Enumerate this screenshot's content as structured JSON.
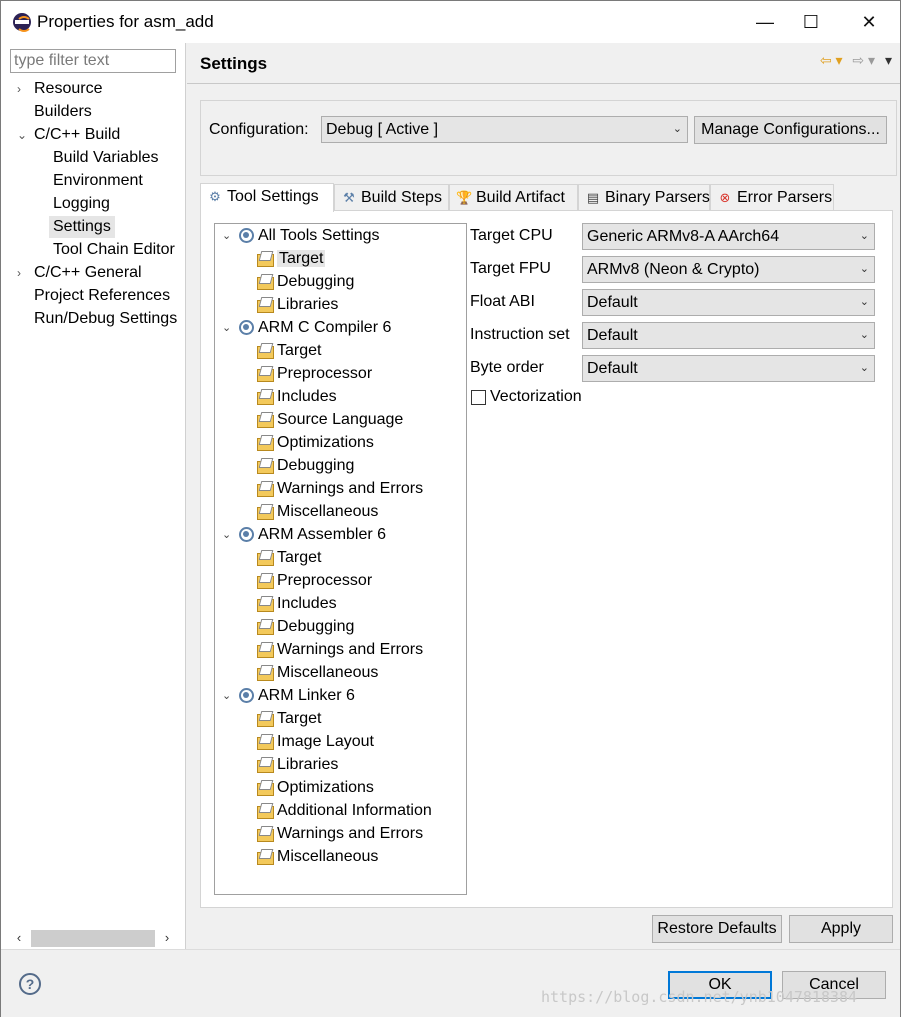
{
  "window": {
    "title": "Properties for asm_add",
    "minimize": "—",
    "maximize": "☐",
    "close": "✕"
  },
  "sidebar": {
    "filter_placeholder": "type filter text",
    "items": [
      {
        "label": "Resource",
        "arrow": "›"
      },
      {
        "label": "Builders",
        "arrow": ""
      },
      {
        "label": "C/C++ Build",
        "arrow": "⌄"
      },
      {
        "label": "Build Variables",
        "arrow": ""
      },
      {
        "label": "Environment",
        "arrow": ""
      },
      {
        "label": "Logging",
        "arrow": ""
      },
      {
        "label": "Settings",
        "arrow": "",
        "selected": true
      },
      {
        "label": "Tool Chain Editor",
        "arrow": ""
      },
      {
        "label": "C/C++ General",
        "arrow": "›"
      },
      {
        "label": "Project References",
        "arrow": ""
      },
      {
        "label": "Run/Debug Settings",
        "arrow": ""
      }
    ],
    "scroll_left": "‹",
    "scroll_right": "›"
  },
  "page": {
    "heading": "Settings",
    "nav_back": "⇦ ▾",
    "nav_forward": "⇨ ▾",
    "nav_menu": "▾"
  },
  "configuration": {
    "label": "Configuration:",
    "value": "Debug  [ Active ]",
    "manage_button": "Manage Configurations..."
  },
  "tabs": [
    {
      "label": "Tool Settings",
      "icon": "tool-settings-icon",
      "active": true
    },
    {
      "label": "Build Steps",
      "icon": "build-steps-icon"
    },
    {
      "label": "Build Artifact",
      "icon": "trophy-icon"
    },
    {
      "label": "Binary Parsers",
      "icon": "binary-icon"
    },
    {
      "label": "Error Parsers",
      "icon": "error-icon"
    }
  ],
  "tree": [
    {
      "label": "All Tools Settings",
      "level": 0,
      "expanded": true
    },
    {
      "label": "Target",
      "level": 1,
      "selected": true
    },
    {
      "label": "Debugging",
      "level": 1
    },
    {
      "label": "Libraries",
      "level": 1
    },
    {
      "label": "ARM C Compiler 6",
      "level": 0,
      "expanded": true
    },
    {
      "label": "Target",
      "level": 1
    },
    {
      "label": "Preprocessor",
      "level": 1
    },
    {
      "label": "Includes",
      "level": 1
    },
    {
      "label": "Source Language",
      "level": 1
    },
    {
      "label": "Optimizations",
      "level": 1
    },
    {
      "label": "Debugging",
      "level": 1
    },
    {
      "label": "Warnings and Errors",
      "level": 1
    },
    {
      "label": "Miscellaneous",
      "level": 1
    },
    {
      "label": "ARM Assembler 6",
      "level": 0,
      "expanded": true
    },
    {
      "label": "Target",
      "level": 1
    },
    {
      "label": "Preprocessor",
      "level": 1
    },
    {
      "label": "Includes",
      "level": 1
    },
    {
      "label": "Debugging",
      "level": 1
    },
    {
      "label": "Warnings and Errors",
      "level": 1
    },
    {
      "label": "Miscellaneous",
      "level": 1
    },
    {
      "label": "ARM Linker 6",
      "level": 0,
      "expanded": true
    },
    {
      "label": "Target",
      "level": 1
    },
    {
      "label": "Image Layout",
      "level": 1
    },
    {
      "label": "Libraries",
      "level": 1
    },
    {
      "label": "Optimizations",
      "level": 1
    },
    {
      "label": "Additional Information",
      "level": 1
    },
    {
      "label": "Warnings and Errors",
      "level": 1
    },
    {
      "label": "Miscellaneous",
      "level": 1
    }
  ],
  "fields": [
    {
      "label": "Target CPU",
      "value": "Generic ARMv8-A AArch64"
    },
    {
      "label": "Target FPU",
      "value": "ARMv8 (Neon & Crypto)"
    },
    {
      "label": "Float ABI",
      "value": "Default"
    },
    {
      "label": "Instruction set",
      "value": "Default"
    },
    {
      "label": "Byte order",
      "value": "Default"
    }
  ],
  "vectorization": {
    "label": "Vectorization",
    "checked": false
  },
  "buttons": {
    "restore_defaults": "Restore Defaults",
    "apply": "Apply",
    "ok": "OK",
    "cancel": "Cancel",
    "help": "?"
  },
  "watermark": "https://blog.csdn.net/ynb1047818384",
  "colors": {
    "default_button_border": "#0078d7",
    "selection_bg": "#e5e5e5",
    "tool_icon": "#5b7fa8",
    "folder_icon": "#f3c95b"
  }
}
